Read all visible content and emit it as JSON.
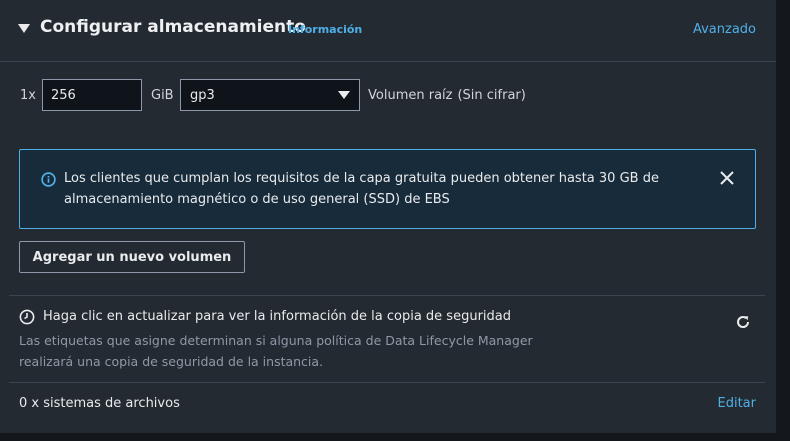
{
  "header": {
    "title": "Configurar almacenamiento",
    "info_link": "Información",
    "advanced_link": "Avanzado"
  },
  "volume": {
    "count": "1x",
    "size_value": "256",
    "unit": "GiB",
    "type": "gp3",
    "root_label": "Volumen raíz",
    "encryption": "(Sin cifrar)"
  },
  "alert": {
    "text": "Los clientes que cumplan los requisitos de la capa gratuita pueden obtener hasta 30 GB de almacenamiento magnético o de uso general (SSD) de EBS"
  },
  "add_volume_button": "Agregar un nuevo volumen",
  "backup": {
    "title": "Haga clic en actualizar para ver la información de la copia de seguridad",
    "description": "Las etiquetas que asigne determinan si alguna política de Data Lifecycle Manager realizará una copia de seguridad de la instancia."
  },
  "filesystems": {
    "label": "0 x sistemas de archivos",
    "edit_link": "Editar"
  },
  "colors": {
    "accent": "#4fb0e8",
    "panel": "#242a31",
    "alert_bg": "#182b3a"
  }
}
